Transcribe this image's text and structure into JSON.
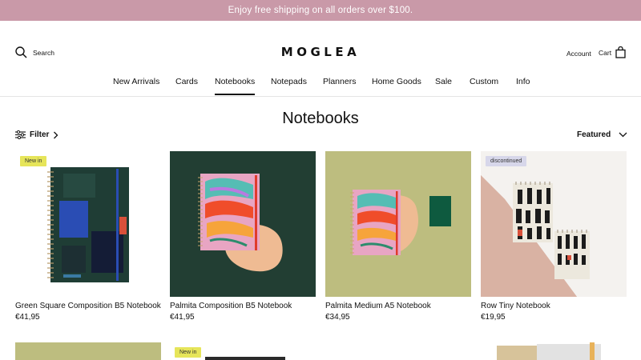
{
  "announcement": "Enjoy free shipping on all orders over $100.",
  "header": {
    "search_label": "Search",
    "logo": "MOGLEA",
    "account_label": "Account",
    "cart_label": "Cart"
  },
  "nav": {
    "items": [
      "New Arrivals",
      "Cards",
      "Notebooks",
      "Notepads",
      "Planners",
      "Home Goods",
      "Sale",
      "Custom",
      "Info"
    ],
    "active": "Notebooks"
  },
  "page_title": "Notebooks",
  "toolbar": {
    "filter_label": "Filter",
    "sort_label": "Featured"
  },
  "products": [
    {
      "name": "Green Square Composition B5 Notebook",
      "price": "€41,95",
      "badge": "New in"
    },
    {
      "name": "Palmita Composition B5 Notebook",
      "price": "€41,95",
      "badge": ""
    },
    {
      "name": "Palmita Medium A5 Notebook",
      "price": "€34,95",
      "badge": ""
    },
    {
      "name": "Row Tiny Notebook",
      "price": "€19,95",
      "badge": "discontinued"
    }
  ],
  "next_row": [
    {
      "badge": ""
    },
    {
      "badge": "New in"
    },
    {
      "badge": ""
    },
    {
      "badge": ""
    }
  ],
  "colors": {
    "announcement_bg": "#c999a8",
    "badge_new": "#e6e55a",
    "badge_discontinued": "#d7d7ea"
  }
}
